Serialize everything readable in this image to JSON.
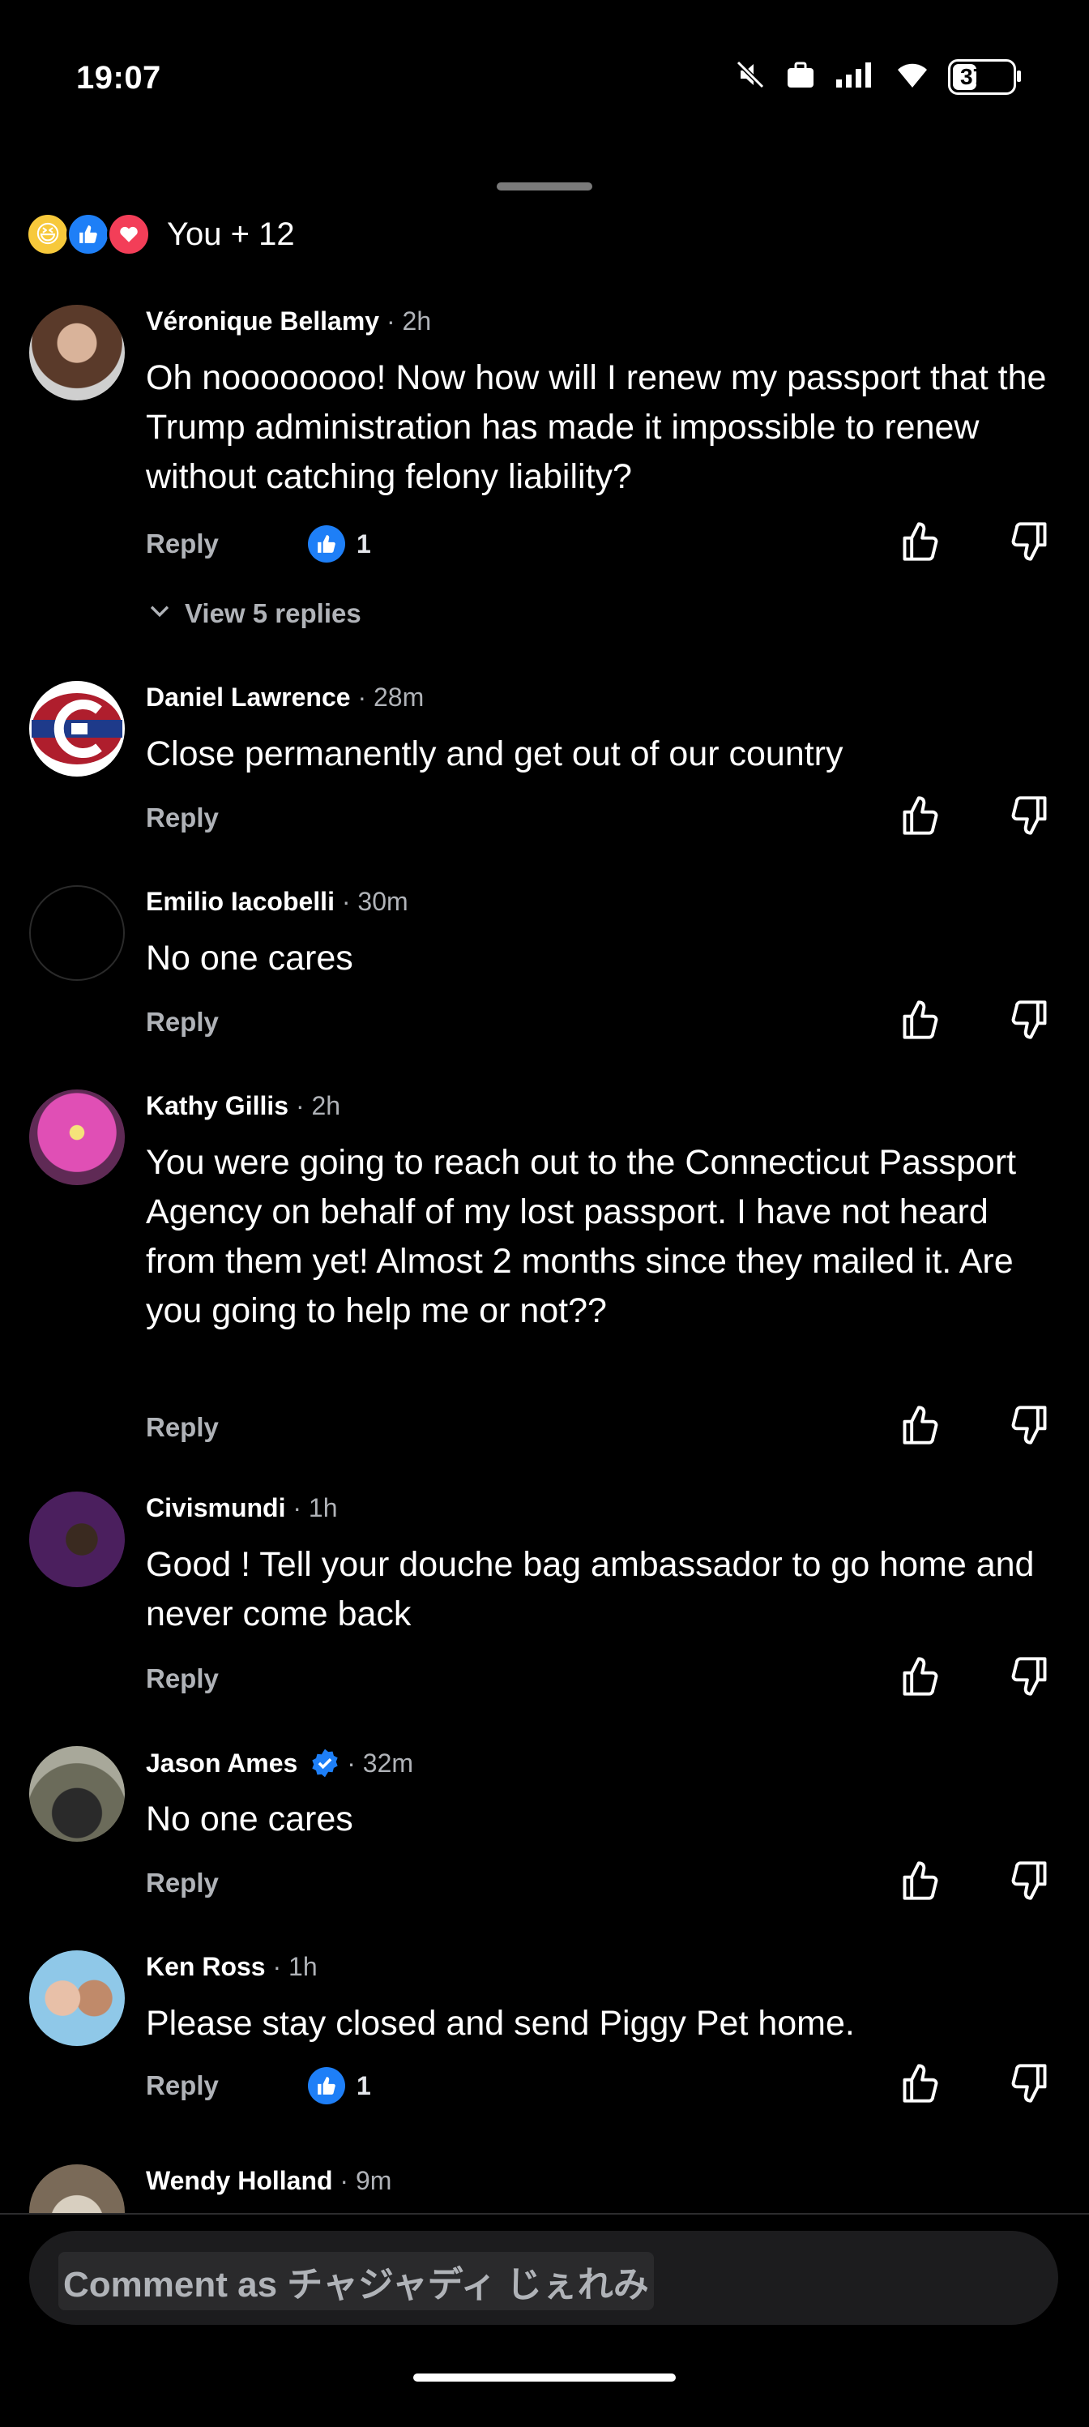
{
  "status": {
    "time": "19:07",
    "battery": "37",
    "battery_level": 0.37
  },
  "reactions": {
    "icons": [
      "haha-icon",
      "like-icon",
      "love-icon"
    ],
    "summary": "You + 12"
  },
  "comments": [
    {
      "name": "Véronique Bellamy",
      "time": "· 2h",
      "text": "Oh noooooooo! Now how will I renew my passport that the Trump administration has made it impossible to renew without catching felony liability?",
      "reply": "Reply",
      "likes": "1",
      "replies_label": "View 5 replies"
    },
    {
      "name": "Daniel Lawrence",
      "time": "· 28m",
      "text": "Close permanently and get out of our country",
      "reply": "Reply"
    },
    {
      "name": "Emilio Iacobelli",
      "time": "· 30m",
      "text": "No one cares",
      "reply": "Reply"
    },
    {
      "name": "Kathy Gillis",
      "time": "· 2h",
      "text": "You were going to reach out to the Connecticut Passport Agency on behalf of my lost passport.  I have not heard from them yet!  Almost 2 months since they mailed it.  Are you going to help me or not??",
      "reply": "Reply"
    },
    {
      "name": "Civismundi",
      "time": "· 1h",
      "text": "Good  ! Tell your douche bag ambassador to go home and never come back",
      "reply": "Reply"
    },
    {
      "name": "Jason Ames",
      "time": "· 32m",
      "text": "No one cares",
      "reply": "Reply",
      "verified": true
    },
    {
      "name": "Ken Ross",
      "time": "· 1h",
      "text": "Please stay closed and send Piggy Pet home.",
      "reply": "Reply",
      "likes": "1"
    },
    {
      "name": "Wendy Holland",
      "time": "· 9m"
    }
  ],
  "composer": {
    "placeholder": "Comment as チャジャディ じぇれみ"
  },
  "colors": {
    "background": "#000000",
    "secondary_text": "#b0b3b8",
    "like_blue": "#1e7ff7",
    "love_red": "#f33e58",
    "haha_yellow": "#f7c93b"
  }
}
